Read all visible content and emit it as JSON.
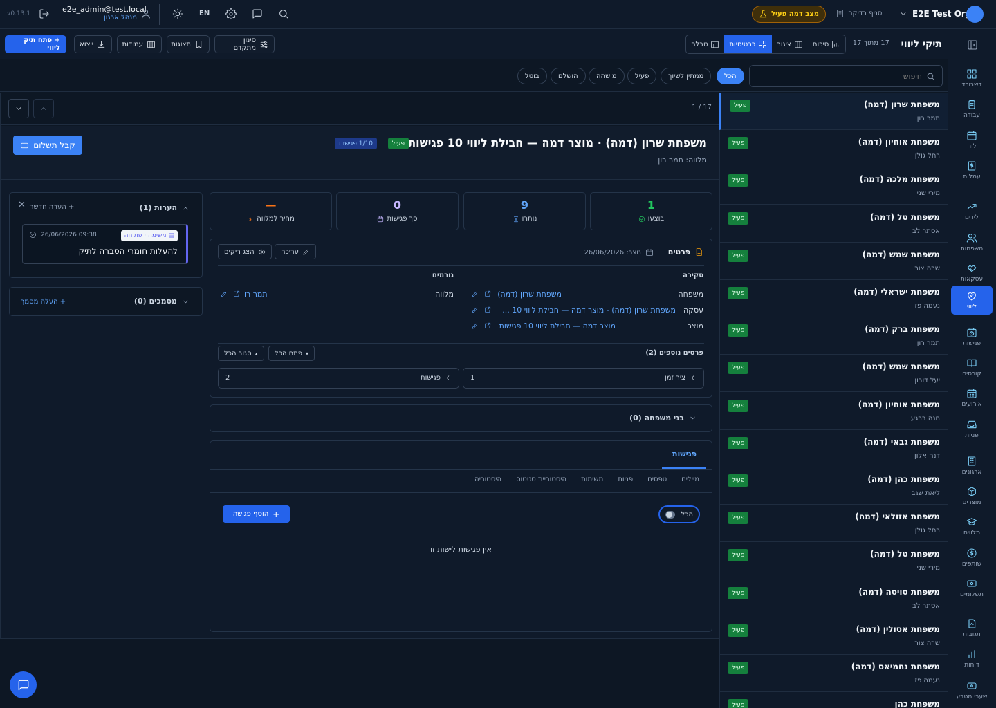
{
  "topbar": {
    "version": "v0.13.1",
    "user_email": "e2e_admin@test.local",
    "user_role": "מנהל ארגון",
    "lang": "EN",
    "org_name": "E2E Test Org",
    "branch": "סניף בדיקה",
    "demo_mode": "מצב דמה פעיל"
  },
  "sidebar": {
    "items": [
      {
        "label": "דשבורד",
        "icon": "dashboard-icon"
      },
      {
        "label": "עבודה",
        "icon": "clipboard-icon"
      },
      {
        "label": "לוח",
        "icon": "calendar-icon"
      },
      {
        "label": "עמלות",
        "icon": "dollar-doc-icon"
      },
      {
        "label": "לידים",
        "icon": "trend-up-icon"
      },
      {
        "label": "משפחות",
        "icon": "users-icon"
      },
      {
        "label": "עסקאות",
        "icon": "handshake-icon"
      },
      {
        "label": "ליווי",
        "icon": "heart-handshake-icon"
      },
      {
        "label": "פגישות",
        "icon": "calendar-clock-icon"
      },
      {
        "label": "קורסים",
        "icon": "book-icon"
      },
      {
        "label": "אירועים",
        "icon": "calendar-grid-icon"
      },
      {
        "label": "פניות",
        "icon": "inbox-icon"
      },
      {
        "label": "ארגונים",
        "icon": "building-icon"
      },
      {
        "label": "מוצרים",
        "icon": "package-icon"
      },
      {
        "label": "מלווים",
        "icon": "graduation-cap-icon"
      },
      {
        "label": "שותפים",
        "icon": "coin-icon"
      },
      {
        "label": "תשלומים",
        "icon": "banknote-icon"
      },
      {
        "label": "תגובות",
        "icon": "doc-reply-icon"
      },
      {
        "label": "דוחות",
        "icon": "bar-chart-icon"
      },
      {
        "label": "שערי מטבע",
        "icon": "currency-icon"
      }
    ]
  },
  "toolbar": {
    "title": "תיקי ליווי",
    "count": "17 מתוך 17",
    "views": [
      "טבלה",
      "כרטיסיות",
      "ציגור",
      "סיכום"
    ],
    "advanced_filter": "סינון מתקדם",
    "saved_views": "תצוגות",
    "columns": "עמודות",
    "export": "ייצוא",
    "open_new": "+ פתח תיק ליווי"
  },
  "filters": {
    "search_placeholder": "חיפוש",
    "pills": [
      "הכל",
      "ממתין לשיוך",
      "פעיל",
      "מושהה",
      "הושלם",
      "בוטל"
    ]
  },
  "list": {
    "status": "פעיל",
    "rows": [
      {
        "title": "משפחת שרון (דמה)",
        "sub": "תמר רון"
      },
      {
        "title": "משפחת אוחיון (דמה)",
        "sub": "רחל גולן"
      },
      {
        "title": "משפחת מלכה (דמה)",
        "sub": "מירי שני"
      },
      {
        "title": "משפחת טל (דמה)",
        "sub": "אסתר לב"
      },
      {
        "title": "משפחת שמש (דמה)",
        "sub": "שרה צור"
      },
      {
        "title": "משפחת ישראלי (דמה)",
        "sub": "נעמה פז"
      },
      {
        "title": "משפחת ברק (דמה)",
        "sub": "תמר רון"
      },
      {
        "title": "משפחת שמש (דמה)",
        "sub": "יעל דורון"
      },
      {
        "title": "משפחת אוחיון (דמה)",
        "sub": "חנה ברגע"
      },
      {
        "title": "משפחת גבאי (דמה)",
        "sub": "דנה אלון"
      },
      {
        "title": "משפחת כהן (דמה)",
        "sub": "ליאת שגב"
      },
      {
        "title": "משפחת אזולאי (דמה)",
        "sub": "רחל גולן"
      },
      {
        "title": "משפחת טל (דמה)",
        "sub": "מירי שני"
      },
      {
        "title": "משפחת סויסה (דמה)",
        "sub": "אסתר לב"
      },
      {
        "title": "משפחת אסולין (דמה)",
        "sub": "שרה צור"
      },
      {
        "title": "משפחת נחמיאס (דמה)",
        "sub": "נעמה פז"
      },
      {
        "title": "משפחת כהן",
        "sub": ""
      }
    ]
  },
  "detail": {
    "pager": "1 / 17",
    "title": "משפחת שרון (דמה) · מוצר דמה — חבילת ליווי 10 פגישות",
    "status": "פעיל",
    "sessions_badge": "1/10 פגישות",
    "mentor_line": "מלווה: תמר רון",
    "pay_button": "קבל תשלום",
    "stats": [
      {
        "value": "1",
        "label": "בוצעו",
        "color": "#22c55e"
      },
      {
        "value": "9",
        "label": "נותרו",
        "color": "#60a5fa"
      },
      {
        "value": "0",
        "label": "סך פגישות",
        "color": "#c4b5fd"
      },
      {
        "value": "—",
        "label": "מחיר למלווה",
        "color": "#f97316"
      }
    ],
    "details": {
      "heading": "פרטים",
      "created": "נוצר: 26/06/2026",
      "edit": "עריכה",
      "show_empty": "הצג ריקים",
      "overview_heading": "סקירה",
      "parties_heading": "גורמים",
      "family_label": "משפחה",
      "family_value": "משפחת שרון (דמה)",
      "deal_label": "עסקה",
      "deal_value": "משפחת שרון (דמה) - מוצר דמה — חבילת ליווי 10 ...",
      "product_label": "מוצר",
      "product_value": "מוצר דמה — חבילת ליווי 10 פגישות",
      "mentor_label": "מלווה",
      "mentor_value": "תמר רון",
      "more_heading": "פרטים נוספים (2)",
      "expand_all": "פתח הכל",
      "collapse_all": "סגור הכל",
      "timeline_label": "ציר זמן",
      "timeline_count": "1",
      "meetings_label": "פגישות",
      "meetings_count": "2"
    },
    "family_members": "בני משפחה (0)",
    "meetings": {
      "heading": "פגישות",
      "tabs": [
        "מיילים",
        "טפסים",
        "פניות",
        "משימות",
        "היסטוריית סטטוס",
        "היסטוריה"
      ],
      "toggle_label": "הכל",
      "add_button": "הוסף פגישה",
      "empty": "אין פגישות לישות זו"
    },
    "notes": {
      "heading": "הערות (1)",
      "new_note": "+ הערה חדשה",
      "note_tag": "משימה · פתוחה",
      "note_time": "09:38 26/06/2026",
      "note_text": "להעלות חומרי הסברה לתיק"
    },
    "docs": {
      "heading": "מסמכים (0)",
      "upload": "+ העלה מסמך"
    }
  }
}
